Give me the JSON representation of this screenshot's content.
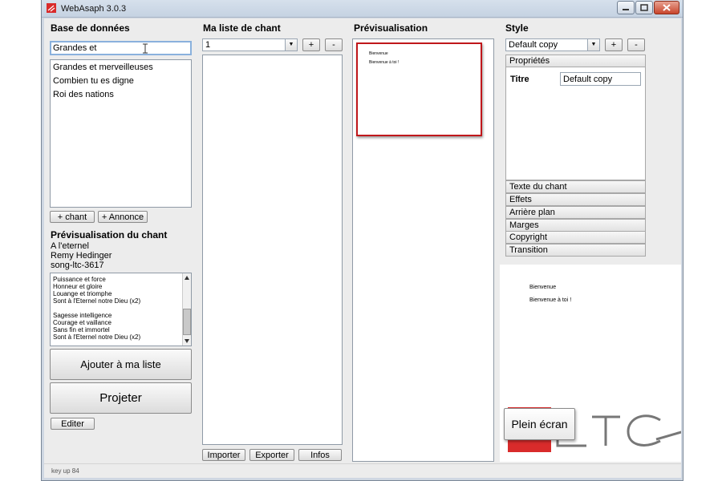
{
  "window": {
    "title": "WebAsaph 3.0.3"
  },
  "database": {
    "heading": "Base de données",
    "search_value": "Grandes et",
    "results": [
      "Grandes et merveilleuses",
      "Combien tu es digne",
      "Roi des nations"
    ],
    "add_song_label": "+ chant",
    "add_announce_label": "+ Annonce"
  },
  "song_preview": {
    "heading": "Prévisualisation du chant",
    "title": "A l'eternel",
    "author": "Remy Hedinger",
    "id": "song-ltc-3617",
    "lyrics": [
      "Puissance et force",
      "Honneur et gloire",
      "Louange et triomphe",
      "Sont à l'Eternel notre Dieu (x2)",
      "",
      "Sagesse intelligence",
      "Courage et vaillance",
      "Sans fin et immortel",
      "Sont à l'Eternel notre Dieu (x2)"
    ],
    "add_to_list_label": "Ajouter à ma liste",
    "project_label": "Projeter",
    "edit_label": "Editer"
  },
  "my_list": {
    "heading": "Ma liste de chant",
    "selected": "1",
    "plus_label": "+",
    "minus_label": "-",
    "import_label": "Importer",
    "export_label": "Exporter",
    "info_label": "Infos"
  },
  "preview": {
    "heading": "Prévisualisation",
    "slide_line1": "Bienvenue",
    "slide_line2": "Bienvenue à toi !"
  },
  "style": {
    "heading": "Style",
    "selected": "Default copy",
    "plus_label": "+",
    "minus_label": "-",
    "properties_label": "Propriétés",
    "title_label": "Titre",
    "title_value": "Default copy",
    "sections": [
      "Texte du chant",
      "Effets",
      "Arrière plan",
      "Marges",
      "Copyright",
      "Transition"
    ]
  },
  "live": {
    "line1": "Bienvenue",
    "line2": "Bienvenue à toi !",
    "fullscreen_label": "Plein écran",
    "logo_text": "LTC"
  },
  "status": {
    "text": "key up 84"
  },
  "colors": {
    "preview_border": "#c0171b",
    "logo_red": "#d92b2b"
  }
}
